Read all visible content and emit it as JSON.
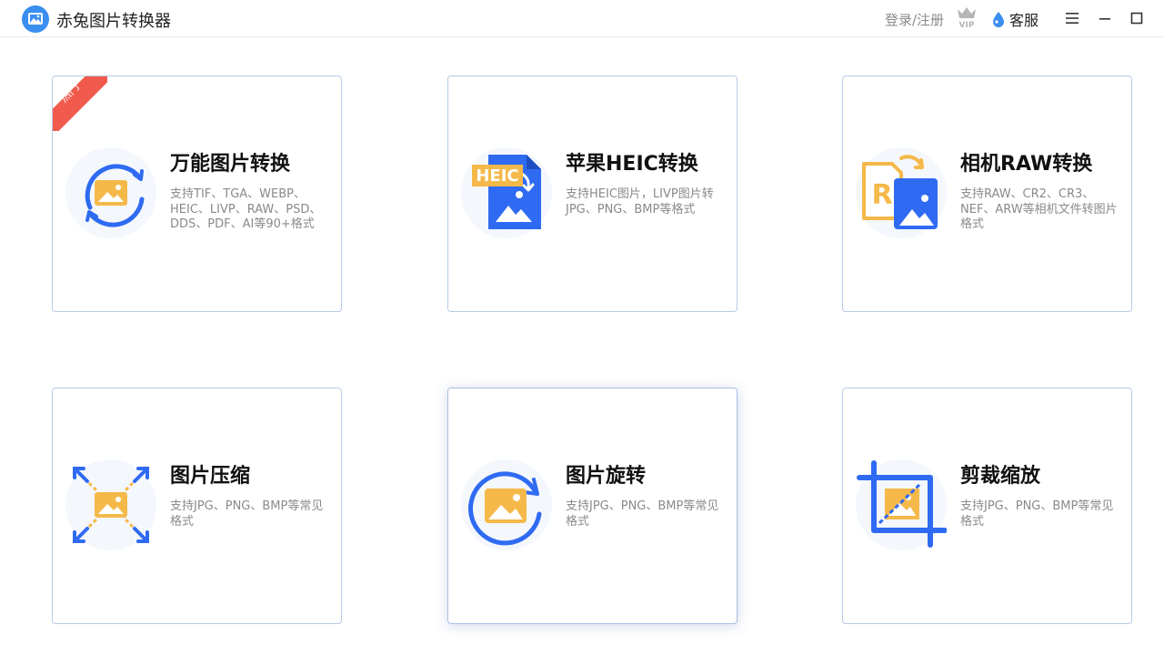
{
  "app": {
    "title": "赤兔图片转换器",
    "login_label": "登录/注册",
    "vip_badge": "VIP",
    "service_label": "客服"
  },
  "colors": {
    "brand_blue": "#2f6bf2",
    "accent_yellow": "#f5b94a",
    "hot_red": "#f25a4d",
    "card_border": "#b7cbe6"
  },
  "cards": [
    {
      "title": "万能图片转换",
      "desc": "支持TIF、TGA、WEBP、HEIC、LIVP、RAW、PSD、DDS、PDF、AI等90+格式",
      "icon": "universal-convert-icon",
      "badge": "热门"
    },
    {
      "title": "苹果HEIC转换",
      "desc": "支持HEIC图片，LIVP图片转JPG、PNG、BMP等格式",
      "icon": "heic-convert-icon",
      "icon_text": "HEIC"
    },
    {
      "title": "相机RAW转换",
      "desc": "支持RAW、CR2、CR3、NEF、ARW等相机文件转图片格式",
      "icon": "raw-convert-icon",
      "icon_text": "R"
    },
    {
      "title": "图片压缩",
      "desc": "支持JPG、PNG、BMP等常见格式",
      "icon": "compress-icon"
    },
    {
      "title": "图片旋转",
      "desc": "支持JPG、PNG、BMP等常见格式",
      "icon": "rotate-icon"
    },
    {
      "title": "剪裁缩放",
      "desc": "支持JPG、PNG、BMP等常见格式",
      "icon": "crop-icon"
    }
  ]
}
